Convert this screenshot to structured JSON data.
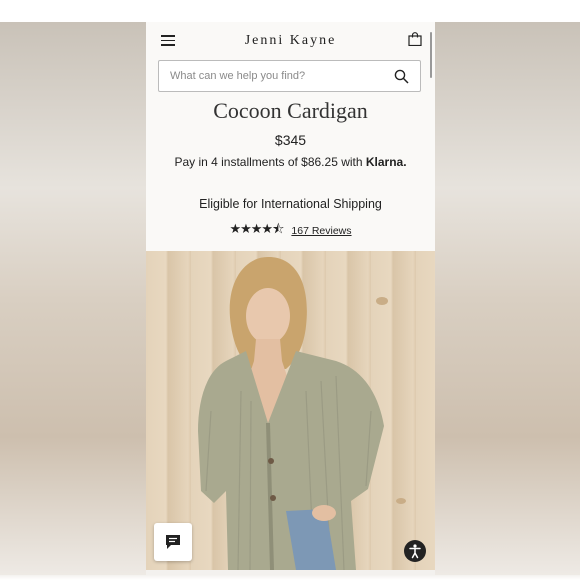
{
  "header": {
    "logo_text": "Jenni Kayne",
    "menu_icon": "hamburger-menu-icon",
    "bag_icon": "shopping-bag-icon"
  },
  "search": {
    "placeholder": "What can we help you find?",
    "icon": "search-icon"
  },
  "product": {
    "title": "Cocoon Cardigan",
    "price": "$345",
    "installments_text": "Pay in 4 installments of $86.25 with ",
    "klarna_label": "Klarna.",
    "shipping_text": "Eligible for International Shipping",
    "rating_value": 4.5,
    "stars_display": "★★★★⯪",
    "reviews_label": "167 Reviews"
  },
  "hero_image": {
    "description_icon": "product-photo"
  },
  "floating": {
    "chat_icon": "chat-icon",
    "accessibility_icon": "accessibility-icon"
  },
  "colors": {
    "background": "#faf9f7",
    "text": "#222222",
    "cardigan": "#a8a890",
    "wood": "#e4d3ba"
  }
}
